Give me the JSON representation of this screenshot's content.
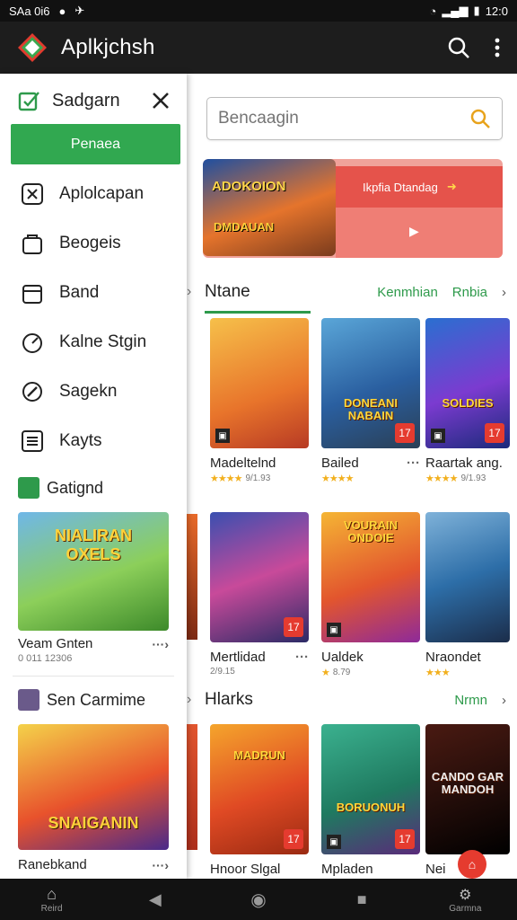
{
  "status": {
    "left_text": "SAa 0i6",
    "time": "12:0"
  },
  "appbar": {
    "title": "Aplkjchsh"
  },
  "search": {
    "placeholder": "Bencaagin"
  },
  "banner": {
    "button_text": "Ikpfia Dtandag",
    "title": "ADOKOION",
    "subtitle": "DMDAUAN"
  },
  "sections": [
    {
      "name": "Ntane",
      "links": [
        "Kenmhian",
        "Rnbia"
      ]
    },
    {
      "name": "Hlarks",
      "links": [
        "Nrmn"
      ]
    }
  ],
  "row1": [
    {
      "name": "Madeltelnd",
      "meta": "9/1.93",
      "badge": "",
      "label": ""
    },
    {
      "name": "Bailed",
      "meta": "",
      "badge": "17",
      "label": "DONEANI NABAIN"
    },
    {
      "name": "Raartak ang.",
      "meta": "9/1.93",
      "badge": "17",
      "label": "SOLDIES"
    }
  ],
  "row2": [
    {
      "name": "Mertlidad",
      "meta": "2/9.15",
      "badge": "17",
      "label": ""
    },
    {
      "name": "Ualdek",
      "meta": "8.79",
      "badge": "",
      "label": "VOURAIN ONDOIE"
    },
    {
      "name": "Nraondet",
      "meta": "",
      "badge": "",
      "label": ""
    }
  ],
  "row3": [
    {
      "name": "Hnoor Slgal",
      "badge": "17",
      "label": "MADRUN"
    },
    {
      "name": "Mpladen",
      "badge": "17",
      "label": "BORUONUH"
    },
    {
      "name": "Nei",
      "badge": "",
      "label": "CANDO GAR MANDOH"
    }
  ],
  "drawer": {
    "title": "Sadgarn",
    "cta": "Penaea",
    "items": [
      "Aplolcapan",
      "Beogeis",
      "Band",
      "Kalne Stgin",
      "Sagekn",
      "Kayts"
    ],
    "section1": "Gatignd",
    "card1": {
      "title": "Veam Gnten",
      "sub": "0 011 12306",
      "art": "NIALIRAN OXELS"
    },
    "section2": "Sen Carmime",
    "card2": {
      "title": "Ranebkand",
      "art": "SNAIGANIN"
    }
  },
  "nav": {
    "home_label": "Reird",
    "games_label": "Garmna"
  }
}
